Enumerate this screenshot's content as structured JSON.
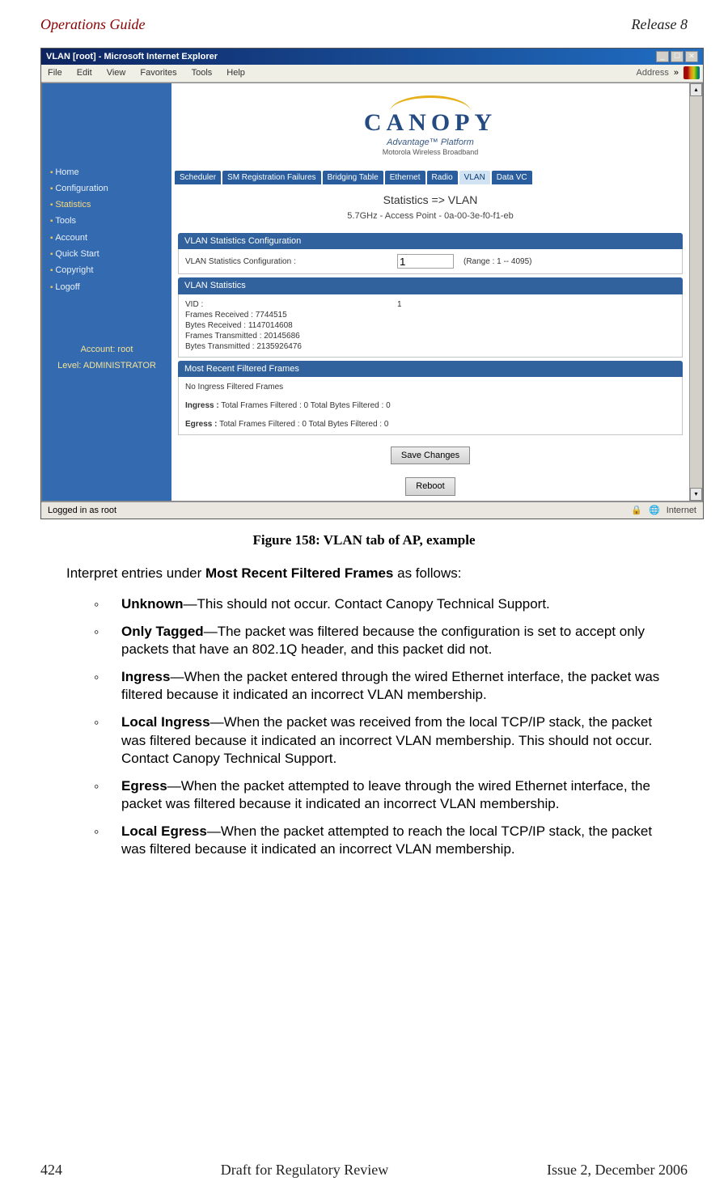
{
  "header": {
    "left": "Operations Guide",
    "right": "Release 8"
  },
  "browser": {
    "window_title": "VLAN [root] - Microsoft Internet Explorer",
    "menu": {
      "file": "File",
      "edit": "Edit",
      "view": "View",
      "favorites": "Favorites",
      "tools": "Tools",
      "help": "Help"
    },
    "address_label": "Address",
    "nav_items": [
      "Home",
      "Configuration",
      "Statistics",
      "Tools",
      "Account",
      "Quick Start",
      "Copyright",
      "Logoff"
    ],
    "nav_selected_index": 2,
    "nav_footer1": "Account: root",
    "nav_footer2": "Level: ADMINISTRATOR",
    "logo": {
      "brand": "CANOPY",
      "sub": "Advantage™ Platform",
      "tag": "Motorola Wireless Broadband"
    },
    "tabs": [
      "Scheduler",
      "SM Registration Failures",
      "Bridging Table",
      "Ethernet",
      "Radio",
      "VLAN",
      "Data VC"
    ],
    "tab_active_index": 5,
    "page_title": "Statistics => VLAN",
    "page_sub": "5.7GHz - Access Point - 0a-00-3e-f0-f1-eb",
    "panel_cfg": {
      "head": "VLAN Statistics Configuration",
      "label": "VLAN Statistics Configuration :",
      "value": "1",
      "range": "(Range : 1 -- 4095)"
    },
    "panel_stats": {
      "head": "VLAN Statistics",
      "vid_label": "VID :",
      "vid_value": "1",
      "frames_rec": "Frames Received : 7744515",
      "bytes_rec": "Bytes Received : 1147014608",
      "frames_tx": "Frames Transmitted : 20145686",
      "bytes_tx": "Bytes Transmitted : 2135926476"
    },
    "panel_filt": {
      "head": "Most Recent Filtered Frames",
      "no_ingress": "No Ingress Filtered Frames",
      "ingress_label": "Ingress :",
      "ingress_text": " Total Frames Filtered : 0 Total Bytes Filtered : 0",
      "egress_label": "Egress :",
      "egress_text": " Total Frames Filtered : 0 Total Bytes Filtered : 0"
    },
    "save_btn": "Save Changes",
    "reboot_btn": "Reboot",
    "status_left": "Logged in as root",
    "status_right": "Internet"
  },
  "figure_caption": "Figure 158: VLAN tab of AP, example",
  "intro_text_pre": "Interpret entries under ",
  "intro_text_bold": "Most Recent Filtered Frames",
  "intro_text_post": " as follows:",
  "definitions": [
    {
      "term": "Unknown",
      "desc": "—This should not occur. Contact Canopy Technical Support."
    },
    {
      "term": "Only Tagged",
      "desc": "—The packet was filtered because the configuration is set to accept only packets that have an 802.1Q header, and this packet did not."
    },
    {
      "term": "Ingress",
      "desc": "—When the packet entered through the wired Ethernet interface, the packet was filtered because it indicated an incorrect VLAN membership."
    },
    {
      "term": "Local Ingress",
      "desc": "—When the packet was received from the local TCP/IP stack, the packet was filtered because it indicated an incorrect VLAN membership. This should not occur. Contact Canopy Technical Support."
    },
    {
      "term": "Egress",
      "desc": "—When the packet attempted to leave through the wired Ethernet interface, the packet was filtered because it indicated an incorrect VLAN membership."
    },
    {
      "term": "Local Egress",
      "desc": "—When the packet attempted to reach the local TCP/IP stack, the packet was filtered because it indicated an incorrect VLAN membership."
    }
  ],
  "footer": {
    "left": "424",
    "center": "Draft for Regulatory Review",
    "right": "Issue 2, December 2006"
  }
}
